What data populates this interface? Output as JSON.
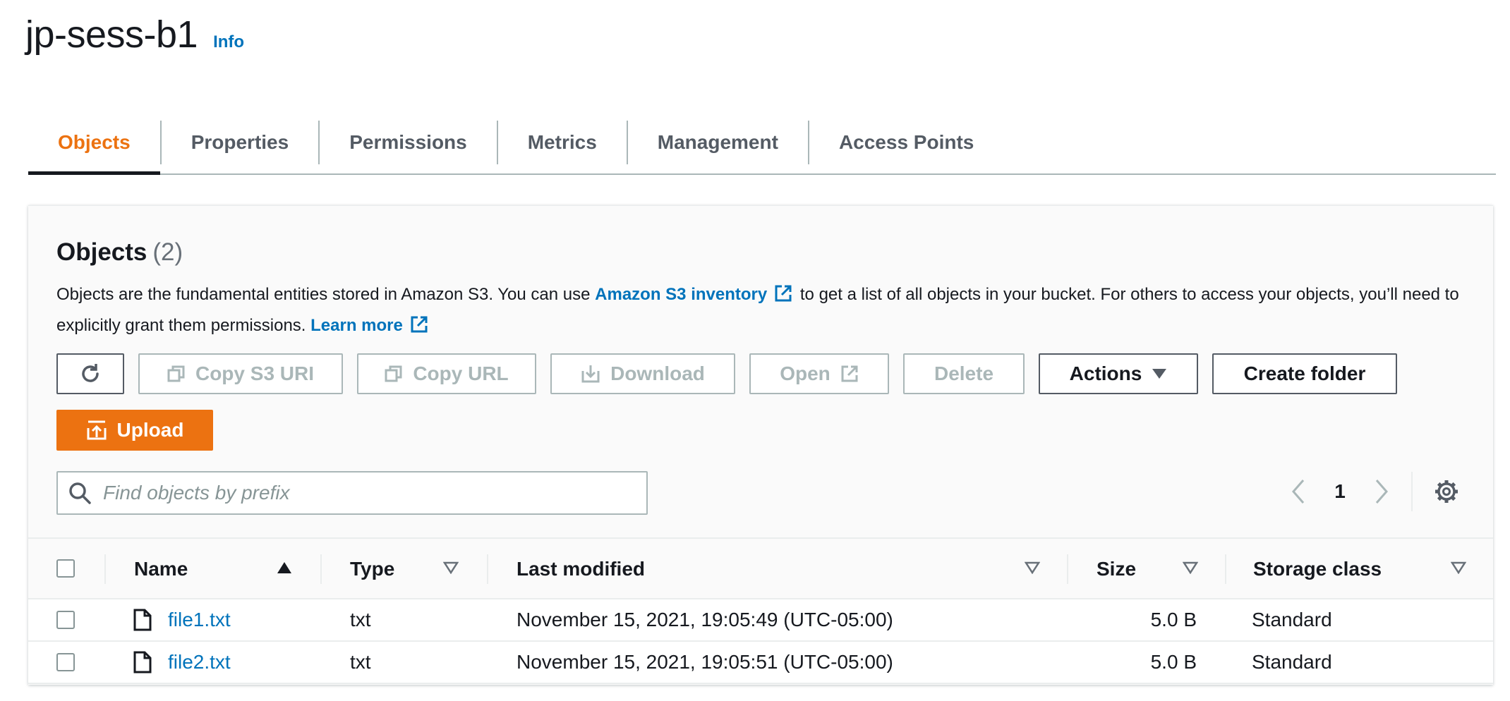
{
  "header": {
    "title": "jp-sess-b1",
    "info_label": "Info"
  },
  "tabs": [
    {
      "label": "Objects",
      "active": true
    },
    {
      "label": "Properties"
    },
    {
      "label": "Permissions"
    },
    {
      "label": "Metrics"
    },
    {
      "label": "Management"
    },
    {
      "label": "Access Points"
    }
  ],
  "panel": {
    "title": "Objects",
    "count": "(2)",
    "desc_part1": "Objects are the fundamental entities stored in Amazon S3. You can use ",
    "inventory_link": "Amazon S3 inventory",
    "desc_part2": " to get a list of all objects in your bucket. For others to access your objects, you’ll need to explicitly grant them permissions. ",
    "learn_more": "Learn more"
  },
  "toolbar": {
    "refresh_icon": "refresh-icon",
    "copy_s3_uri": "Copy S3 URI",
    "copy_url": "Copy URL",
    "download": "Download",
    "open": "Open",
    "delete": "Delete",
    "actions": "Actions",
    "create_folder": "Create folder",
    "upload": "Upload"
  },
  "search": {
    "placeholder": "Find objects by prefix",
    "value": ""
  },
  "pagination": {
    "current_page": "1"
  },
  "table": {
    "columns": {
      "name": "Name",
      "type": "Type",
      "last_modified": "Last modified",
      "size": "Size",
      "storage_class": "Storage class"
    },
    "rows": [
      {
        "name": "file1.txt",
        "type": "txt",
        "last_modified": "November 15, 2021, 19:05:49 (UTC-05:00)",
        "size": "5.0 B",
        "storage_class": "Standard"
      },
      {
        "name": "file2.txt",
        "type": "txt",
        "last_modified": "November 15, 2021, 19:05:51 (UTC-05:00)",
        "size": "5.0 B",
        "storage_class": "Standard"
      }
    ]
  },
  "colors": {
    "accent_orange": "#ec7211",
    "link_blue": "#0073bb",
    "text_dark": "#16191f",
    "disabled_gray": "#aab7b8"
  }
}
